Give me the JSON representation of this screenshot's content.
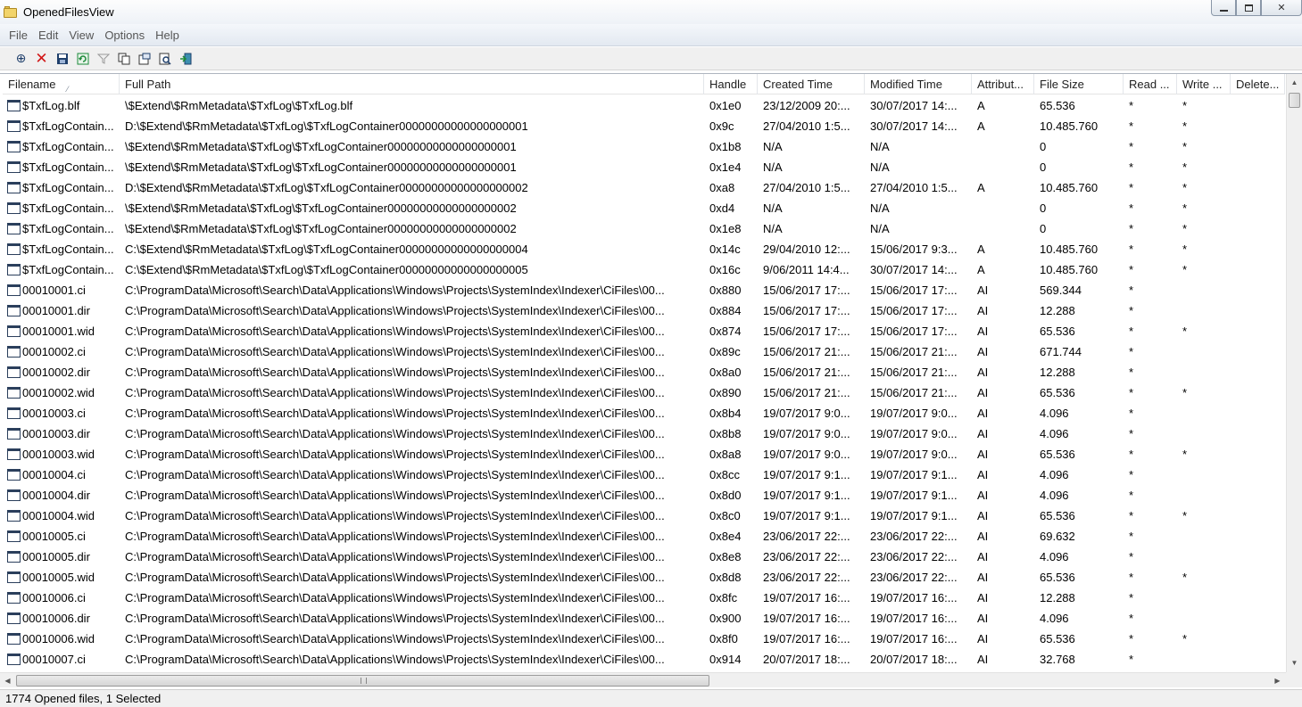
{
  "window": {
    "title": "OpenedFilesView",
    "icon": "folder-icon"
  },
  "menu": [
    "File",
    "Edit",
    "View",
    "Options",
    "Help"
  ],
  "toolbar": [
    "properties-crosshair-icon",
    "close-handle-x-icon",
    "save-icon",
    "refresh-icon",
    "filter-icon",
    "copy-icon",
    "html-report-icon",
    "find-icon",
    "exit-icon"
  ],
  "columns": [
    "Filename",
    "Full Path",
    "Handle",
    "Created Time",
    "Modified Time",
    "Attribut...",
    "File Size",
    "Read ...",
    "Write ...",
    "Delete..."
  ],
  "rows": [
    [
      "$TxfLog.blf",
      "\\$Extend\\$RmMetadata\\$TxfLog\\$TxfLog.blf",
      "0x1e0",
      "23/12/2009 20:...",
      "30/07/2017 14:...",
      "A",
      "65.536",
      "*",
      "*",
      ""
    ],
    [
      "$TxfLogContain...",
      "D:\\$Extend\\$RmMetadata\\$TxfLog\\$TxfLogContainer00000000000000000001",
      "0x9c",
      "27/04/2010 1:5...",
      "30/07/2017 14:...",
      "A",
      "10.485.760",
      "*",
      "*",
      ""
    ],
    [
      "$TxfLogContain...",
      "\\$Extend\\$RmMetadata\\$TxfLog\\$TxfLogContainer00000000000000000001",
      "0x1b8",
      "N/A",
      "N/A",
      "",
      "0",
      "*",
      "*",
      ""
    ],
    [
      "$TxfLogContain...",
      "\\$Extend\\$RmMetadata\\$TxfLog\\$TxfLogContainer00000000000000000001",
      "0x1e4",
      "N/A",
      "N/A",
      "",
      "0",
      "*",
      "*",
      ""
    ],
    [
      "$TxfLogContain...",
      "D:\\$Extend\\$RmMetadata\\$TxfLog\\$TxfLogContainer00000000000000000002",
      "0xa8",
      "27/04/2010 1:5...",
      "27/04/2010 1:5...",
      "A",
      "10.485.760",
      "*",
      "*",
      ""
    ],
    [
      "$TxfLogContain...",
      "\\$Extend\\$RmMetadata\\$TxfLog\\$TxfLogContainer00000000000000000002",
      "0xd4",
      "N/A",
      "N/A",
      "",
      "0",
      "*",
      "*",
      ""
    ],
    [
      "$TxfLogContain...",
      "\\$Extend\\$RmMetadata\\$TxfLog\\$TxfLogContainer00000000000000000002",
      "0x1e8",
      "N/A",
      "N/A",
      "",
      "0",
      "*",
      "*",
      ""
    ],
    [
      "$TxfLogContain...",
      "C:\\$Extend\\$RmMetadata\\$TxfLog\\$TxfLogContainer00000000000000000004",
      "0x14c",
      "29/04/2010 12:...",
      "15/06/2017 9:3...",
      "A",
      "10.485.760",
      "*",
      "*",
      ""
    ],
    [
      "$TxfLogContain...",
      "C:\\$Extend\\$RmMetadata\\$TxfLog\\$TxfLogContainer00000000000000000005",
      "0x16c",
      "9/06/2011 14:4...",
      "30/07/2017 14:...",
      "A",
      "10.485.760",
      "*",
      "*",
      ""
    ],
    [
      "00010001.ci",
      "C:\\ProgramData\\Microsoft\\Search\\Data\\Applications\\Windows\\Projects\\SystemIndex\\Indexer\\CiFiles\\00...",
      "0x880",
      "15/06/2017 17:...",
      "15/06/2017 17:...",
      "AI",
      "569.344",
      "*",
      "",
      ""
    ],
    [
      "00010001.dir",
      "C:\\ProgramData\\Microsoft\\Search\\Data\\Applications\\Windows\\Projects\\SystemIndex\\Indexer\\CiFiles\\00...",
      "0x884",
      "15/06/2017 17:...",
      "15/06/2017 17:...",
      "AI",
      "12.288",
      "*",
      "",
      ""
    ],
    [
      "00010001.wid",
      "C:\\ProgramData\\Microsoft\\Search\\Data\\Applications\\Windows\\Projects\\SystemIndex\\Indexer\\CiFiles\\00...",
      "0x874",
      "15/06/2017 17:...",
      "15/06/2017 17:...",
      "AI",
      "65.536",
      "*",
      "*",
      ""
    ],
    [
      "00010002.ci",
      "C:\\ProgramData\\Microsoft\\Search\\Data\\Applications\\Windows\\Projects\\SystemIndex\\Indexer\\CiFiles\\00...",
      "0x89c",
      "15/06/2017 21:...",
      "15/06/2017 21:...",
      "AI",
      "671.744",
      "*",
      "",
      ""
    ],
    [
      "00010002.dir",
      "C:\\ProgramData\\Microsoft\\Search\\Data\\Applications\\Windows\\Projects\\SystemIndex\\Indexer\\CiFiles\\00...",
      "0x8a0",
      "15/06/2017 21:...",
      "15/06/2017 21:...",
      "AI",
      "12.288",
      "*",
      "",
      ""
    ],
    [
      "00010002.wid",
      "C:\\ProgramData\\Microsoft\\Search\\Data\\Applications\\Windows\\Projects\\SystemIndex\\Indexer\\CiFiles\\00...",
      "0x890",
      "15/06/2017 21:...",
      "15/06/2017 21:...",
      "AI",
      "65.536",
      "*",
      "*",
      ""
    ],
    [
      "00010003.ci",
      "C:\\ProgramData\\Microsoft\\Search\\Data\\Applications\\Windows\\Projects\\SystemIndex\\Indexer\\CiFiles\\00...",
      "0x8b4",
      "19/07/2017 9:0...",
      "19/07/2017 9:0...",
      "AI",
      "4.096",
      "*",
      "",
      ""
    ],
    [
      "00010003.dir",
      "C:\\ProgramData\\Microsoft\\Search\\Data\\Applications\\Windows\\Projects\\SystemIndex\\Indexer\\CiFiles\\00...",
      "0x8b8",
      "19/07/2017 9:0...",
      "19/07/2017 9:0...",
      "AI",
      "4.096",
      "*",
      "",
      ""
    ],
    [
      "00010003.wid",
      "C:\\ProgramData\\Microsoft\\Search\\Data\\Applications\\Windows\\Projects\\SystemIndex\\Indexer\\CiFiles\\00...",
      "0x8a8",
      "19/07/2017 9:0...",
      "19/07/2017 9:0...",
      "AI",
      "65.536",
      "*",
      "*",
      ""
    ],
    [
      "00010004.ci",
      "C:\\ProgramData\\Microsoft\\Search\\Data\\Applications\\Windows\\Projects\\SystemIndex\\Indexer\\CiFiles\\00...",
      "0x8cc",
      "19/07/2017 9:1...",
      "19/07/2017 9:1...",
      "AI",
      "4.096",
      "*",
      "",
      ""
    ],
    [
      "00010004.dir",
      "C:\\ProgramData\\Microsoft\\Search\\Data\\Applications\\Windows\\Projects\\SystemIndex\\Indexer\\CiFiles\\00...",
      "0x8d0",
      "19/07/2017 9:1...",
      "19/07/2017 9:1...",
      "AI",
      "4.096",
      "*",
      "",
      ""
    ],
    [
      "00010004.wid",
      "C:\\ProgramData\\Microsoft\\Search\\Data\\Applications\\Windows\\Projects\\SystemIndex\\Indexer\\CiFiles\\00...",
      "0x8c0",
      "19/07/2017 9:1...",
      "19/07/2017 9:1...",
      "AI",
      "65.536",
      "*",
      "*",
      ""
    ],
    [
      "00010005.ci",
      "C:\\ProgramData\\Microsoft\\Search\\Data\\Applications\\Windows\\Projects\\SystemIndex\\Indexer\\CiFiles\\00...",
      "0x8e4",
      "23/06/2017 22:...",
      "23/06/2017 22:...",
      "AI",
      "69.632",
      "*",
      "",
      ""
    ],
    [
      "00010005.dir",
      "C:\\ProgramData\\Microsoft\\Search\\Data\\Applications\\Windows\\Projects\\SystemIndex\\Indexer\\CiFiles\\00...",
      "0x8e8",
      "23/06/2017 22:...",
      "23/06/2017 22:...",
      "AI",
      "4.096",
      "*",
      "",
      ""
    ],
    [
      "00010005.wid",
      "C:\\ProgramData\\Microsoft\\Search\\Data\\Applications\\Windows\\Projects\\SystemIndex\\Indexer\\CiFiles\\00...",
      "0x8d8",
      "23/06/2017 22:...",
      "23/06/2017 22:...",
      "AI",
      "65.536",
      "*",
      "*",
      ""
    ],
    [
      "00010006.ci",
      "C:\\ProgramData\\Microsoft\\Search\\Data\\Applications\\Windows\\Projects\\SystemIndex\\Indexer\\CiFiles\\00...",
      "0x8fc",
      "19/07/2017 16:...",
      "19/07/2017 16:...",
      "AI",
      "12.288",
      "*",
      "",
      ""
    ],
    [
      "00010006.dir",
      "C:\\ProgramData\\Microsoft\\Search\\Data\\Applications\\Windows\\Projects\\SystemIndex\\Indexer\\CiFiles\\00...",
      "0x900",
      "19/07/2017 16:...",
      "19/07/2017 16:...",
      "AI",
      "4.096",
      "*",
      "",
      ""
    ],
    [
      "00010006.wid",
      "C:\\ProgramData\\Microsoft\\Search\\Data\\Applications\\Windows\\Projects\\SystemIndex\\Indexer\\CiFiles\\00...",
      "0x8f0",
      "19/07/2017 16:...",
      "19/07/2017 16:...",
      "AI",
      "65.536",
      "*",
      "*",
      ""
    ],
    [
      "00010007.ci",
      "C:\\ProgramData\\Microsoft\\Search\\Data\\Applications\\Windows\\Projects\\SystemIndex\\Indexer\\CiFiles\\00...",
      "0x914",
      "20/07/2017 18:...",
      "20/07/2017 18:...",
      "AI",
      "32.768",
      "*",
      "",
      ""
    ]
  ],
  "status": "1774 Opened files, 1 Selected"
}
